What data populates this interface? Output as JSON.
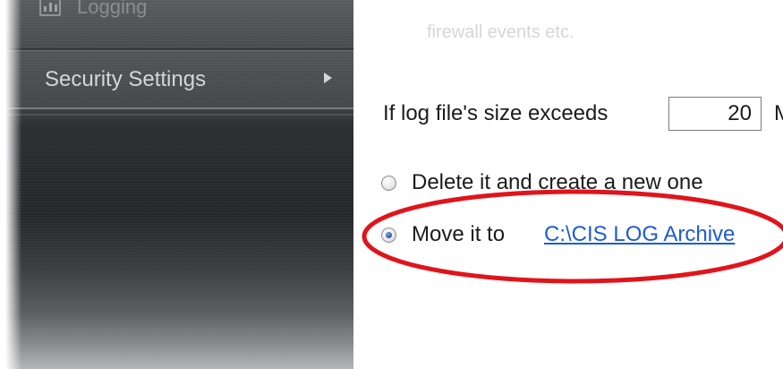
{
  "sidebar": {
    "items": [
      {
        "label": "Logging",
        "icon": "bar-chart-icon"
      },
      {
        "label": "Security Settings",
        "icon": "chevron-right-icon"
      }
    ]
  },
  "main": {
    "description_fragment": "firewall events etc.",
    "log_size_label": "If log file's size exceeds",
    "log_size_value": "20",
    "log_size_unit": "M",
    "options": [
      {
        "label": "Delete it and create a new one",
        "selected": false
      },
      {
        "label": "Move it to",
        "selected": true
      }
    ],
    "archive_path": "C:\\CIS LOG Archive"
  },
  "annotation": {
    "highlight_color": "#e1141b"
  }
}
